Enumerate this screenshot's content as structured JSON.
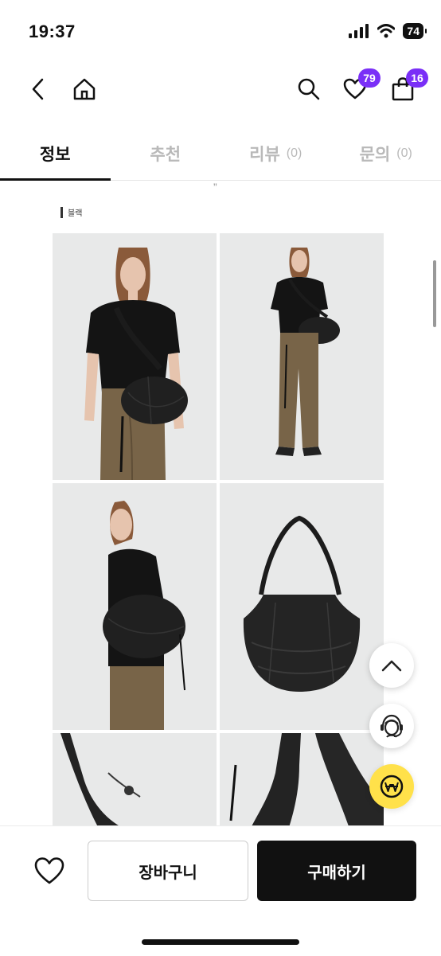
{
  "status": {
    "time": "19:37",
    "battery": "74"
  },
  "nav": {
    "wishlist_count": "79",
    "cart_count": "16"
  },
  "tabs": [
    {
      "label": "정보",
      "count": ""
    },
    {
      "label": "추천",
      "count": ""
    },
    {
      "label": "리뷰",
      "count": "(0)"
    },
    {
      "label": "문의",
      "count": "(0)"
    }
  ],
  "content": {
    "quote_mark": "”",
    "color_label": "블랙"
  },
  "bottom": {
    "cart_label": "장바구니",
    "buy_label": "구매하기"
  },
  "icons": [
    "signal-icon",
    "wifi-icon",
    "back-icon",
    "home-icon",
    "search-icon",
    "heart-icon",
    "bag-icon",
    "scroll-top-icon",
    "chat-support-icon",
    "won-coin-icon"
  ],
  "colors": {
    "accent": "#7a2ff7",
    "yellow_fab": "#ffe14a",
    "buy_button": "#111111"
  }
}
